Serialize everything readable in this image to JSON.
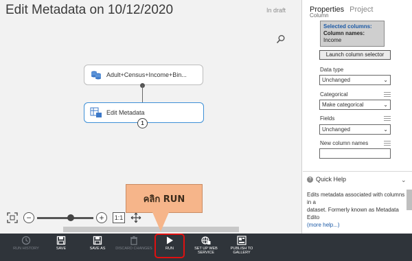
{
  "experiment": {
    "title": "Edit Metadata on 10/12/2020",
    "status": "In draft"
  },
  "modules": {
    "dataset_label": "Adult+Census+Income+Bin...",
    "edit_label": "Edit Metadata",
    "output_port": "1"
  },
  "zoom": {
    "one_to_one": "1:1"
  },
  "callout": {
    "text": "คลิก RUN"
  },
  "panel": {
    "tab_properties": "Properties",
    "tab_project": "Project",
    "section": "Column",
    "selected_columns_label": "Selected columns:",
    "column_names_label": "Column names:",
    "column_names_value": "Income",
    "launch_button": "Launch column selector",
    "data_type_label": "Data type",
    "data_type_value": "Unchanged",
    "categorical_label": "Categorical",
    "categorical_value": "Make categorical",
    "fields_label": "Fields",
    "fields_value": "Unchanged",
    "new_column_names_label": "New column names"
  },
  "quick_help": {
    "title": "Quick Help",
    "line1": "Edits metadata associated with columns in a",
    "line2": "dataset. Formerly known as Metadata Edito",
    "more": "(more help...)"
  },
  "toolbar": {
    "run_history": "RUN HISTORY",
    "save": "SAVE",
    "save_as": "SAVE AS",
    "discard": "DISCARD CHANGES",
    "run": "RUN",
    "setup_web_service": "SET UP WEB SERVICE",
    "publish_gallery": "PUBLISH TO GALLERY"
  },
  "colors": {
    "accent": "#3c8fd6",
    "toolbar_bg": "#2f343a",
    "callout": "#f6b58a",
    "run_highlight": "#e01010"
  }
}
